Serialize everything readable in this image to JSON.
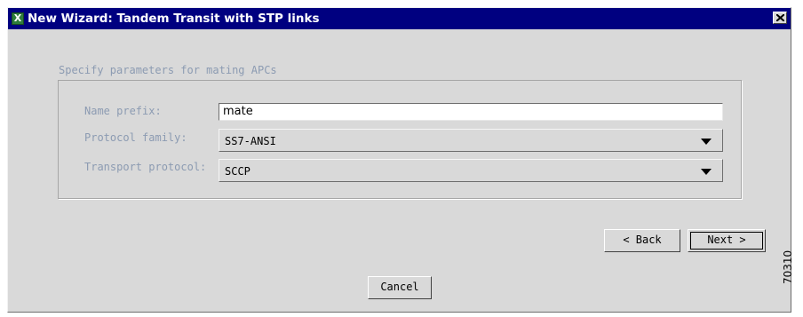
{
  "window": {
    "title": "New Wizard: Tandem Transit with STP links",
    "app_icon_glyph": "X",
    "app_icon_color": "#2e7d3b",
    "titlebar_color": "#000080"
  },
  "section": {
    "heading": "Specify parameters for mating APCs"
  },
  "form": {
    "name_prefix": {
      "label": "Name prefix:",
      "value": "mate"
    },
    "protocol_family": {
      "label": "Protocol family:",
      "value": "SS7-ANSI"
    },
    "transport_protocol": {
      "label": "Transport protocol:",
      "value": "SCCP"
    }
  },
  "buttons": {
    "back": "< Back",
    "next": "Next >",
    "cancel": "Cancel"
  },
  "figure_number": "70310",
  "icons": {
    "close": "close-icon",
    "app": "app-icon",
    "dropdown": "chevron-down-icon"
  }
}
